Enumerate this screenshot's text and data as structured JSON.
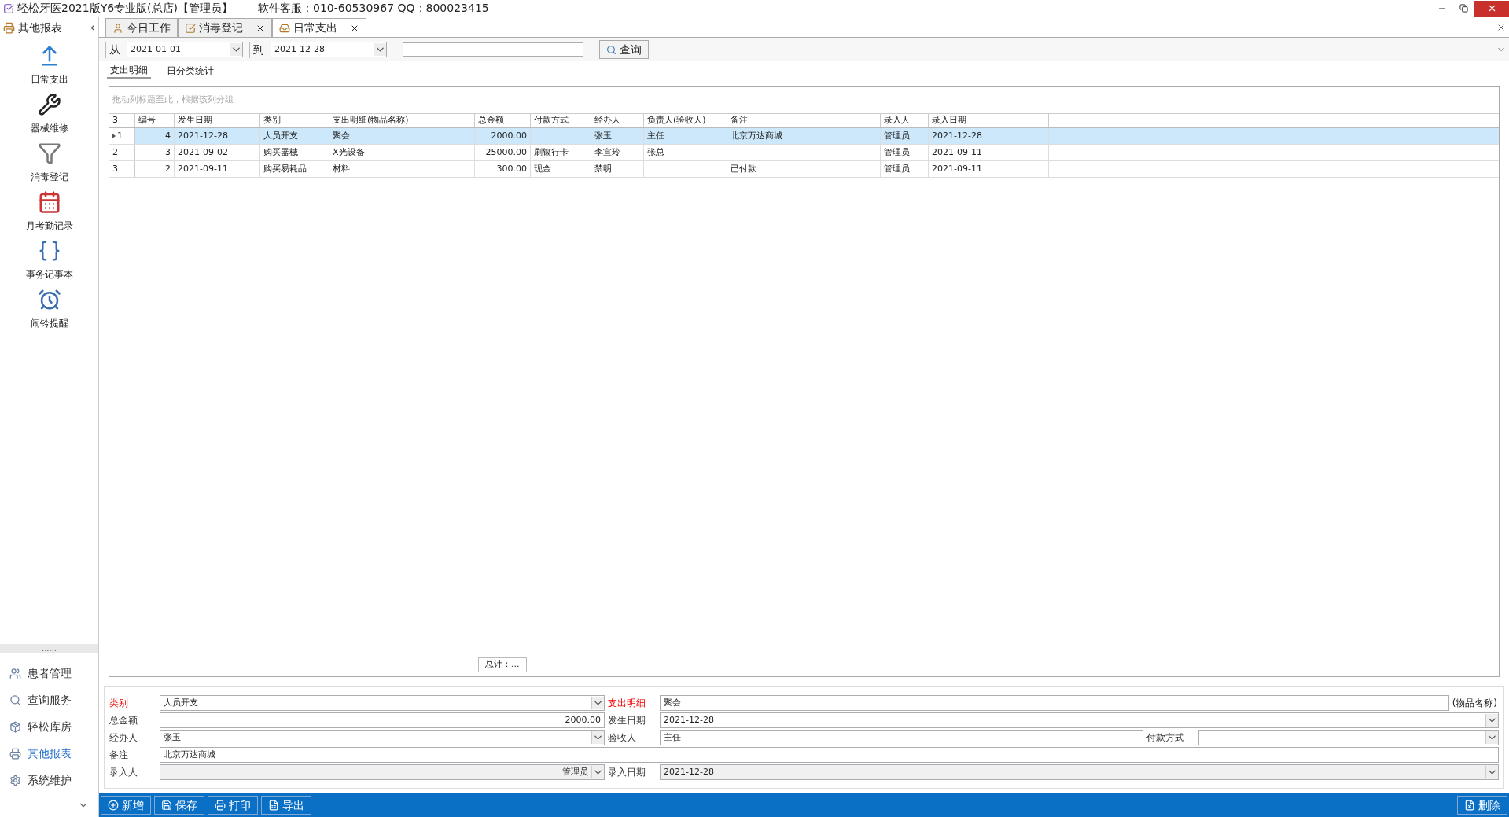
{
  "window": {
    "title": "轻松牙医2021版Y6专业版(总店)【管理员】",
    "support": "软件客服：010-60530967 QQ：800023415"
  },
  "sidebar": {
    "title": "其他报表",
    "collapse": "‹",
    "items": [
      {
        "label": "日常支出"
      },
      {
        "label": "器械维修"
      },
      {
        "label": "消毒登记"
      },
      {
        "label": "月考勤记录"
      },
      {
        "label": "事务记事本"
      },
      {
        "label": "闹铃提醒"
      }
    ],
    "grip": "......",
    "nav": [
      {
        "label": "患者管理",
        "selected": false
      },
      {
        "label": "查询服务",
        "selected": false
      },
      {
        "label": "轻松库房",
        "selected": false
      },
      {
        "label": "其他报表",
        "selected": true
      },
      {
        "label": "系统维护",
        "selected": false
      }
    ]
  },
  "tabs": [
    {
      "label": "今日工作",
      "closable": false,
      "selected": false
    },
    {
      "label": "消毒登记",
      "closable": true,
      "selected": false
    },
    {
      "label": "日常支出",
      "closable": true,
      "selected": true
    }
  ],
  "filter": {
    "from_label": "从",
    "from": "2021-01-01",
    "to_label": "到",
    "to": "2021-12-28",
    "query": "查询"
  },
  "subtabs": [
    {
      "label": "支出明细",
      "selected": true
    },
    {
      "label": "日分类统计",
      "selected": false
    }
  ],
  "grid": {
    "group_hint": "拖动列标题至此，根据该列分组",
    "count": "3",
    "columns": [
      {
        "label": "编号",
        "numeric": true
      },
      {
        "label": "发生日期",
        "numeric": false
      },
      {
        "label": "类别",
        "numeric": false
      },
      {
        "label": "支出明细(物品名称)",
        "numeric": false
      },
      {
        "label": "总金额",
        "numeric": true
      },
      {
        "label": "付款方式",
        "numeric": false
      },
      {
        "label": "经办人",
        "numeric": false
      },
      {
        "label": "负责人(验收人)",
        "numeric": false
      },
      {
        "label": "备注",
        "numeric": false
      },
      {
        "label": "录入人",
        "numeric": false
      },
      {
        "label": "录入日期",
        "numeric": false
      }
    ],
    "rows": [
      {
        "index": "1",
        "selected": true,
        "cells": [
          "4",
          "2021-12-28",
          "人员开支",
          "聚会",
          "2000.00",
          "",
          "张玉",
          "主任",
          "北京万达商城",
          "管理员",
          "2021-12-28"
        ]
      },
      {
        "index": "2",
        "selected": false,
        "cells": [
          "3",
          "2021-09-02",
          "购买器械",
          "X光设备",
          "25000.00",
          "刷银行卡",
          "李宣玲",
          "张总",
          "",
          "管理员",
          "2021-09-11"
        ]
      },
      {
        "index": "3",
        "selected": false,
        "cells": [
          "2",
          "2021-09-11",
          "购买易耗品",
          "材料",
          "300.00",
          "现金",
          "禁明",
          "",
          "已付款",
          "管理员",
          "2021-09-11"
        ]
      }
    ],
    "total": "总计：..."
  },
  "form": [
    [
      {
        "label": "类别",
        "required": true,
        "kind": "combo",
        "value": "人员开支"
      },
      {
        "label": "支出明细",
        "required": true,
        "kind": "text",
        "value": "聚会",
        "suffix": "(物品名称)"
      }
    ],
    [
      {
        "label": "总金额",
        "required": false,
        "kind": "text",
        "value": "2000.00",
        "numeric": true
      },
      {
        "label": "发生日期",
        "required": false,
        "kind": "combo",
        "value": "2021-12-28"
      }
    ],
    [
      {
        "label": "经办人",
        "required": false,
        "kind": "combo",
        "value": "张玉"
      },
      {
        "label": "验收人",
        "required": false,
        "kind": "text",
        "value": "主任"
      },
      {
        "label": "付款方式",
        "required": false,
        "kind": "combo"
      }
    ],
    [
      {
        "label": "备注",
        "required": false,
        "kind": "text",
        "value": "北京万达商城"
      }
    ],
    [
      {
        "label": "录入人",
        "required": false,
        "kind": "combo",
        "value": "管理员",
        "numeric": true,
        "disabled": true
      },
      {
        "label": "录入日期",
        "required": false,
        "kind": "combo",
        "value": "2021-12-28",
        "disabled": true
      }
    ]
  ],
  "actions": [
    {
      "label": "新增"
    },
    {
      "label": "保存"
    },
    {
      "label": "打印"
    },
    {
      "label": "导出"
    }
  ],
  "delete": "删除"
}
